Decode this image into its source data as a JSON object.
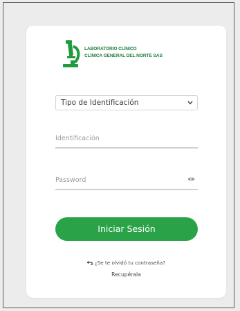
{
  "brand": {
    "line1": "LABORATORIO CLÍNICO",
    "line2": "CLÍNICA GENERAL DEL NORTE SAS",
    "logo_icon": "microscope-icon",
    "color": "#1e7f3a"
  },
  "form": {
    "id_type_select": {
      "selected": "Tipo de Identificación",
      "icon": "chevron-down-icon"
    },
    "id_field": {
      "placeholder": "Identificación"
    },
    "password_field": {
      "placeholder": "Password",
      "icon": "eye-icon"
    },
    "submit_label": "Iniciar Sesión",
    "forgot_text": "¿Se te olvidó tu contraseña?",
    "forgot_icon": "undo-icon",
    "recover_label": "Recupérala"
  },
  "colors": {
    "accent": "#2aa348",
    "background": "#ececec",
    "card": "#ffffff"
  }
}
